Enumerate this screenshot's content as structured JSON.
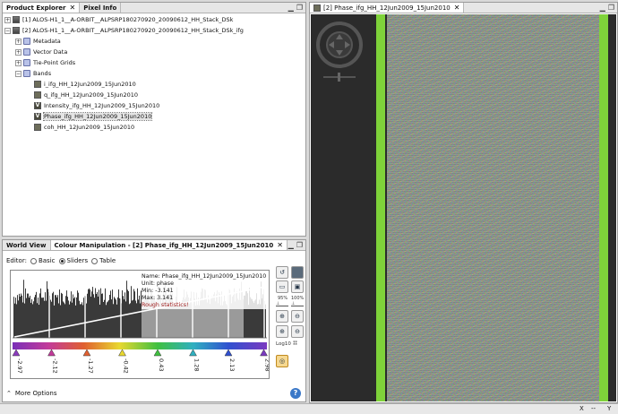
{
  "product_explorer": {
    "tabs": [
      {
        "label": "Product Explorer",
        "close": "✕"
      },
      {
        "label": "Pixel Info"
      }
    ],
    "tree": [
      {
        "label": "[1] ALOS-H1_1__A-ORBIT__ALPSRP180270920_20090612_HH_Stack_DSk",
        "expander": "+",
        "icon": "product-icon"
      },
      {
        "label": "[2] ALOS-H1_1__A-ORBIT__ALPSRP180270920_20090612_HH_Stack_DSk_ifg",
        "expander": "−",
        "icon": "product-icon"
      },
      {
        "label": "Metadata",
        "expander": "+",
        "icon": "folder-icon"
      },
      {
        "label": "Vector Data",
        "expander": "+",
        "icon": "folder-icon"
      },
      {
        "label": "Tie-Point Grids",
        "expander": "+",
        "icon": "folder-icon"
      },
      {
        "label": "Bands",
        "expander": "−",
        "icon": "folder-open-icon"
      },
      {
        "label": "i_ifg_HH_12Jun2009_15Jun2010",
        "icon": "band-icon"
      },
      {
        "label": "q_ifg_HH_12Jun2009_15Jun2010",
        "icon": "band-icon"
      },
      {
        "label": "Intensity_ifg_HH_12Jun2009_15Jun2010",
        "icon": "virtual-band-icon",
        "icon_text": "V"
      },
      {
        "label": "Phase_ifg_HH_12Jun2009_15Jun2010",
        "icon": "virtual-band-icon",
        "icon_text": "V",
        "selected": true
      },
      {
        "label": "coh_HH_12Jun2009_15Jun2010",
        "icon": "band-icon"
      }
    ]
  },
  "colour_panel": {
    "tabs": [
      {
        "label": "World View"
      },
      {
        "label": "Colour Manipulation - [2] Phase_ifg_HH_12Jun2009_15Jun2010",
        "close": "✕"
      }
    ],
    "editor_label": "Editor:",
    "editor_options": [
      "Basic",
      "Sliders",
      "Table"
    ],
    "editor_selected": "Sliders",
    "info": {
      "name": "Name: Phase_ifg_HH_12Jun2009_15Jun2010",
      "unit": "Unit: phase",
      "min": "Min: -3.141",
      "max": "Max: 3.141",
      "rough": "Rough statistics!"
    },
    "slider_labels": [
      "-2.97",
      "-2.12",
      "-1.27",
      "-0.42",
      "0.43",
      "1.28",
      "2.13",
      "2.98"
    ],
    "slider_colors": [
      "#8a3bbd",
      "#c23b9a",
      "#e06030",
      "#e8d830",
      "#40c040",
      "#30b0c0",
      "#3050d0",
      "#7a3ac0"
    ],
    "side_labels": {
      "pct95": "95%",
      "pct100": "100%",
      "log": "Log10"
    },
    "more_options": "More Options",
    "help": "?"
  },
  "image_view": {
    "tab": {
      "label": "[2] Phase_ifg_HH_12Jun2009_15Jun2010",
      "close": "✕"
    },
    "colors": {
      "stripe": "#7fd23a",
      "background": "#2b2b2b"
    }
  },
  "window_controls": {
    "minimize": "▁",
    "restore": "❐"
  },
  "status": {
    "x": "X",
    "dash": "--",
    "y": "Y"
  }
}
